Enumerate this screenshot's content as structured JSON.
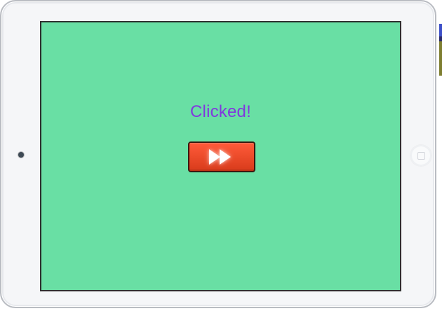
{
  "screen": {
    "status_text": "Clicked!"
  },
  "controls": {
    "fast_forward_button": {
      "icon": "fast-forward-icon"
    }
  },
  "colors": {
    "screen_background": "#69dfa4",
    "status_text": "#8138de",
    "button_fill": "#e9482a",
    "button_border": "#3b170f",
    "device_body": "#f5f6f8"
  }
}
